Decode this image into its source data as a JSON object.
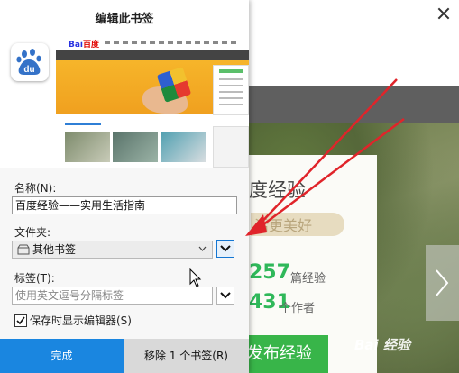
{
  "dialog": {
    "title": "编辑此书签",
    "name_label": "名称(N):",
    "name_value": "百度经验——实用生活指南",
    "folder_label": "文件夹:",
    "folder_value": "其他书签",
    "tags_label": "标签(T):",
    "tags_placeholder": "使用英文逗号分隔标签",
    "show_editor_label": "保存时显示编辑器(S)",
    "show_editor_checked": true,
    "done_button": "完成",
    "remove_button": "移除 1 个书签(R)"
  },
  "preview": {
    "logo_text": "du",
    "site_logo": "Bai",
    "site_logo_suffix": "百度"
  },
  "background_page": {
    "heading": "度经验",
    "slogan": "活更美好",
    "stat_articles": "257",
    "stat_articles_label": "篇经验",
    "stat_authors": "431",
    "stat_authors_label": "个作者",
    "publish_button": "发布经验",
    "watermark": "Bai 经验"
  },
  "colors": {
    "primary_button": "#1a86e0",
    "secondary_button": "#d9d9d9",
    "annotation_arrow": "#e0242a",
    "green_accent": "#2fb85a"
  }
}
